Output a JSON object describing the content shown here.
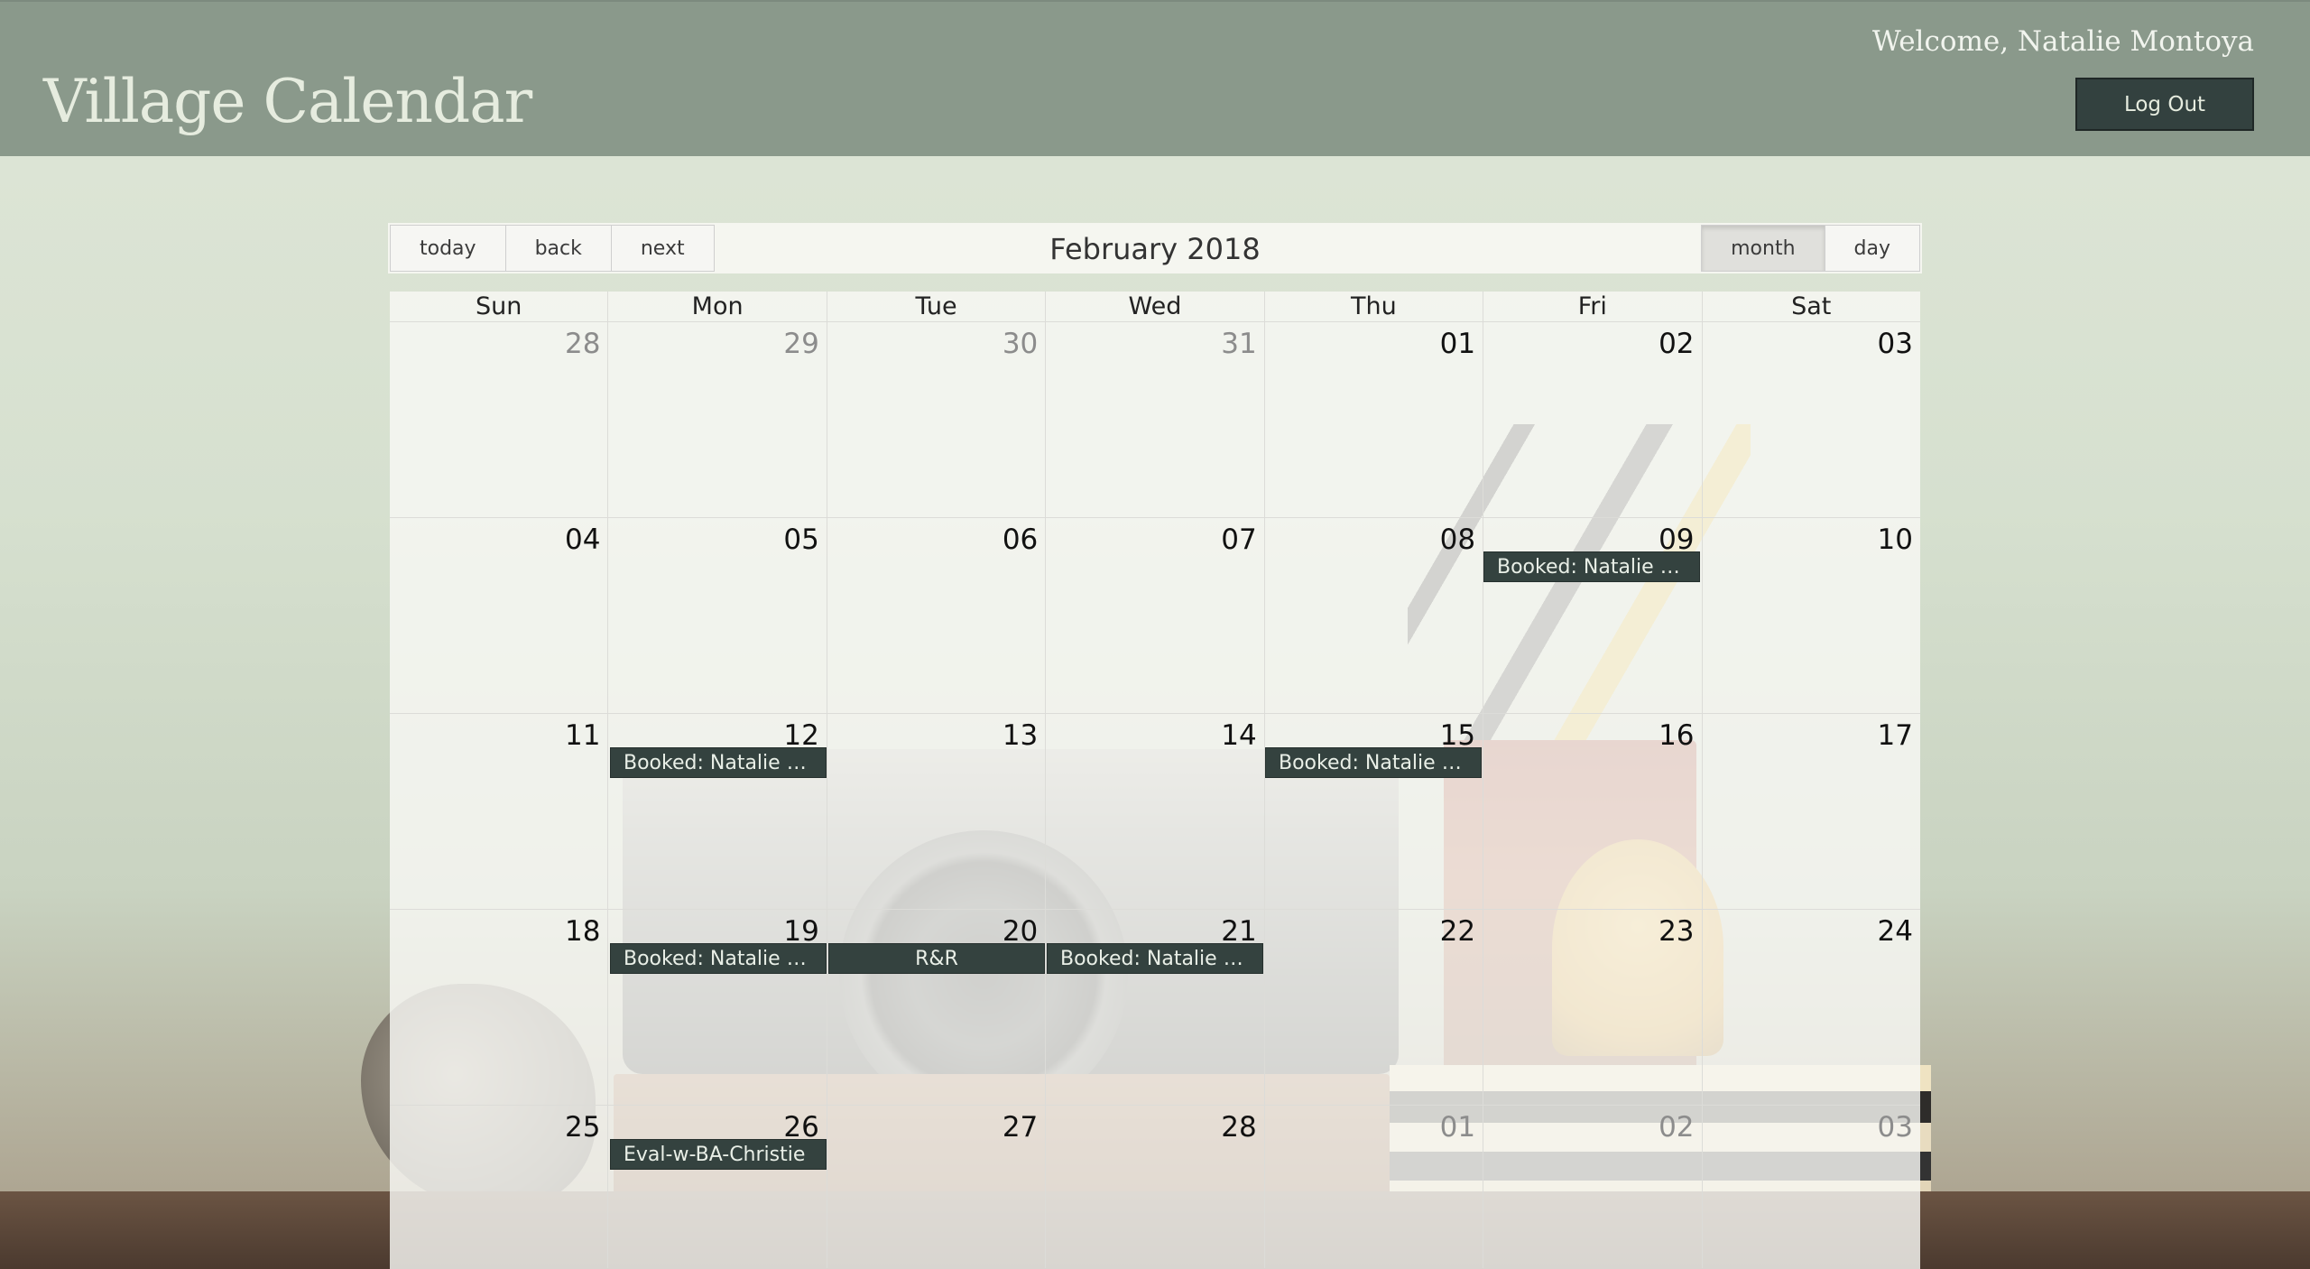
{
  "header": {
    "app_title": "Village Calendar",
    "welcome": "Welcome, Natalie Montoya",
    "logout_label": "Log Out"
  },
  "toolbar": {
    "today_label": "today",
    "back_label": "back",
    "next_label": "next",
    "month_label": "February 2018",
    "view_month_label": "month",
    "view_day_label": "day",
    "active_view": "month"
  },
  "days": [
    "Sun",
    "Mon",
    "Tue",
    "Wed",
    "Thu",
    "Fri",
    "Sat"
  ],
  "weeks": [
    [
      "28",
      "29",
      "30",
      "31",
      "01",
      "02",
      "03"
    ],
    [
      "04",
      "05",
      "06",
      "07",
      "08",
      "09",
      "10"
    ],
    [
      "11",
      "12",
      "13",
      "14",
      "15",
      "16",
      "17"
    ],
    [
      "18",
      "19",
      "20",
      "21",
      "22",
      "23",
      "24"
    ],
    [
      "25",
      "26",
      "27",
      "28",
      "01",
      "02",
      "03"
    ]
  ],
  "events": [
    {
      "label": "Booked: Natalie n...",
      "date": "09"
    },
    {
      "label": "Booked: Natalie n...",
      "date": "12"
    },
    {
      "label": "Booked: Natalie n...",
      "date": "15"
    },
    {
      "label": "Booked: Natalie n...",
      "date": "19"
    },
    {
      "label": "R&R",
      "date": "20"
    },
    {
      "label": "Booked: Natalie n...",
      "date": "21"
    },
    {
      "label": "Eval-w-BA-Christie",
      "date": "26"
    }
  ],
  "colors": {
    "header_bg": "#8a998b",
    "event_bg": "#34423f",
    "logout_bg": "#33413f"
  }
}
